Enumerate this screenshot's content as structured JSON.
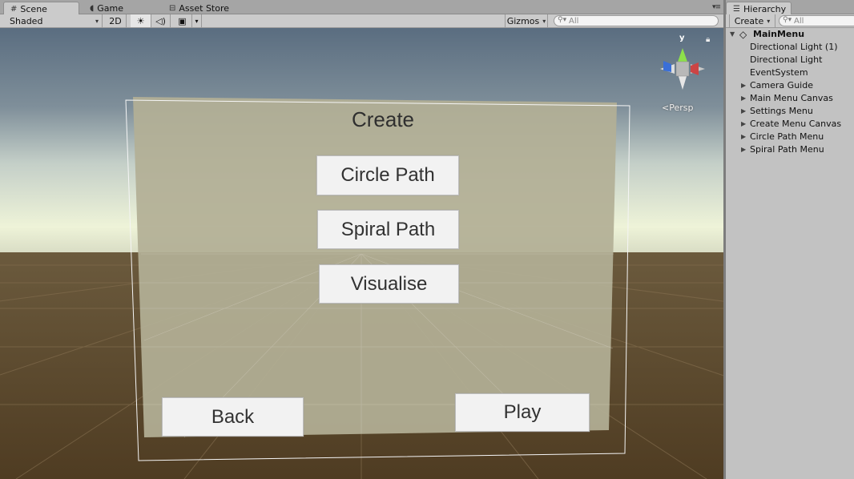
{
  "scene_tabs": [
    {
      "label": "Scene",
      "icon": "grid-icon",
      "active": true
    },
    {
      "label": "Game",
      "icon": "pacman-icon",
      "active": false
    },
    {
      "label": "Asset Store",
      "icon": "store-icon",
      "active": false
    }
  ],
  "scene_toolbar": {
    "shading_mode": "Shaded",
    "mode_2d": "2D",
    "gizmos_label": "Gizmos",
    "search_placeholder": "All"
  },
  "viewport": {
    "canvas_title": "Create",
    "buttons": {
      "circle_path": "Circle Path",
      "spiral_path": "Spiral Path",
      "visualise": "Visualise",
      "back": "Back",
      "play": "Play"
    },
    "gizmo_axis_label": "y",
    "projection_label": "Persp"
  },
  "hierarchy": {
    "tab_label": "Hierarchy",
    "create_label": "Create",
    "search_placeholder": "All",
    "scene_name": "MainMenu",
    "items": [
      {
        "label": "Directional Light (1)",
        "expandable": false
      },
      {
        "label": "Directional Light",
        "expandable": false
      },
      {
        "label": "EventSystem",
        "expandable": false
      },
      {
        "label": "Camera Guide",
        "expandable": true
      },
      {
        "label": "Main Menu Canvas",
        "expandable": true
      },
      {
        "label": "Settings Menu",
        "expandable": true
      },
      {
        "label": "Create Menu Canvas",
        "expandable": true
      },
      {
        "label": "Circle Path Menu",
        "expandable": true
      },
      {
        "label": "Spiral Path Menu",
        "expandable": true
      }
    ]
  },
  "colors": {
    "sky_top": "#5b6f82",
    "horizon": "#e8ecd0",
    "ground": "#5a4528",
    "canvas_fill": "#b3af96",
    "panel_bg": "#c2c2c2"
  }
}
